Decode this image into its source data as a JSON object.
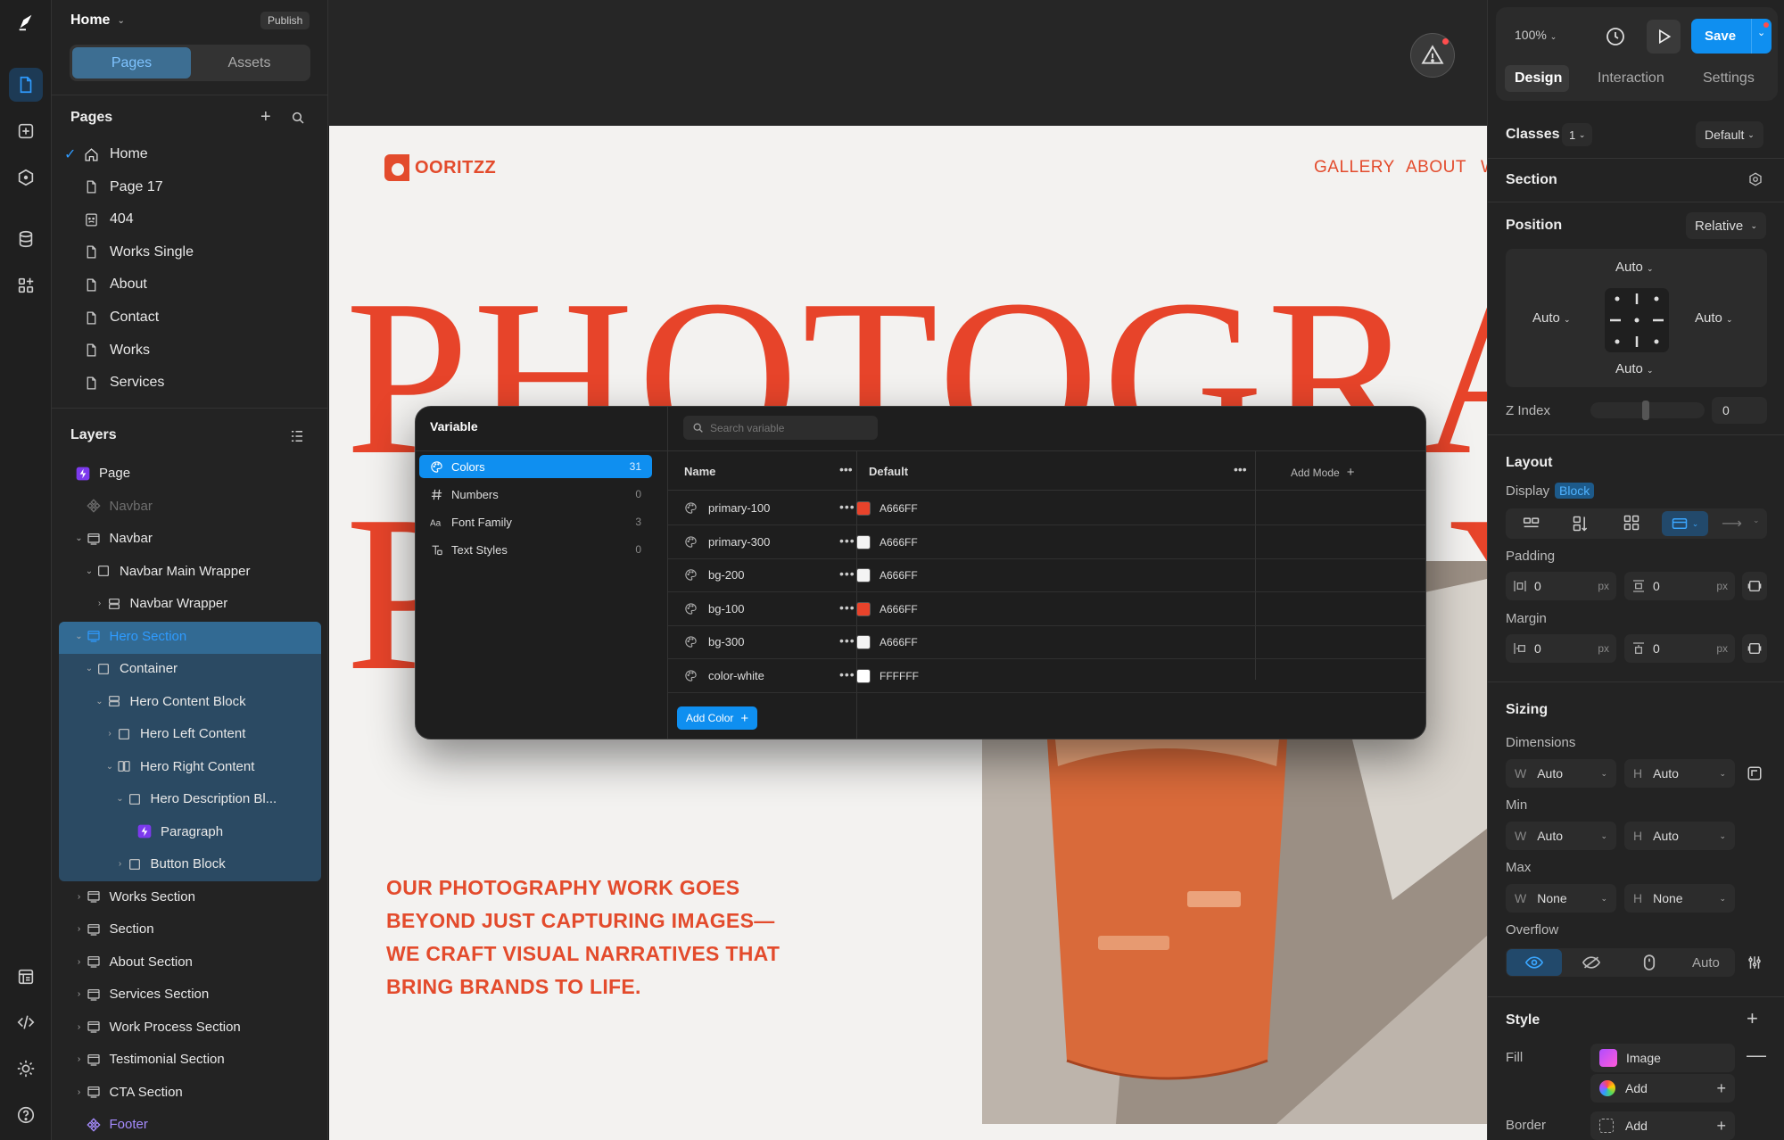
{
  "topbar": {
    "page_name": "Home",
    "publish": "Publish"
  },
  "left": {
    "tab_pages": "Pages",
    "tab_assets": "Assets",
    "pages_heading": "Pages",
    "pages": [
      "Home",
      "Page 17",
      "404",
      "Works Single",
      "About",
      "Contact",
      "Works",
      "Services"
    ],
    "layers_heading": "Layers",
    "layers": [
      {
        "label": "Page",
        "depth": 0,
        "icon": "bolt",
        "color": "#e8e8e8"
      },
      {
        "label": "Navbar",
        "depth": 1,
        "icon": "component",
        "color": "#6e6e6e"
      },
      {
        "label": "Navbar",
        "depth": 1,
        "icon": "section",
        "color": "#e8e8e8",
        "car": "v"
      },
      {
        "label": "Navbar Main Wrapper",
        "depth": 2,
        "icon": "box",
        "color": "#e8e8e8",
        "car": "v"
      },
      {
        "label": "Navbar Wrapper",
        "depth": 3,
        "icon": "stack",
        "color": "#e8e8e8",
        "car": ">"
      },
      {
        "label": "Hero Section",
        "depth": 1,
        "icon": "section",
        "color": "#2f9bff",
        "car": "v"
      },
      {
        "label": "Container",
        "depth": 2,
        "icon": "box",
        "color": "#e8e8e8",
        "car": "v"
      },
      {
        "label": "Hero Content Block",
        "depth": 3,
        "icon": "stack",
        "color": "#e8e8e8",
        "car": "v"
      },
      {
        "label": "Hero Left Content",
        "depth": 4,
        "icon": "box",
        "color": "#e8e8e8",
        "car": ">"
      },
      {
        "label": "Hero Right Content",
        "depth": 4,
        "icon": "cols",
        "color": "#e8e8e8",
        "car": "v"
      },
      {
        "label": "Hero Description Bl...",
        "depth": 5,
        "icon": "box",
        "color": "#e8e8e8",
        "car": "v"
      },
      {
        "label": "Paragraph",
        "depth": 6,
        "icon": "bolt",
        "color": "#e8e8e8"
      },
      {
        "label": "Button Block",
        "depth": 5,
        "icon": "box",
        "color": "#e8e8e8",
        "car": ">"
      },
      {
        "label": "Works Section",
        "depth": 1,
        "icon": "section",
        "color": "#e8e8e8",
        "car": ">"
      },
      {
        "label": "Section",
        "depth": 1,
        "icon": "section",
        "color": "#e8e8e8",
        "car": ">"
      },
      {
        "label": "About Section",
        "depth": 1,
        "icon": "section",
        "color": "#e8e8e8",
        "car": ">"
      },
      {
        "label": "Services Section",
        "depth": 1,
        "icon": "section",
        "color": "#e8e8e8",
        "car": ">"
      },
      {
        "label": "Work Process Section",
        "depth": 1,
        "icon": "section",
        "color": "#e8e8e8",
        "car": ">"
      },
      {
        "label": "Testimonial Section",
        "depth": 1,
        "icon": "section",
        "color": "#e8e8e8",
        "car": ">"
      },
      {
        "label": "CTA Section",
        "depth": 1,
        "icon": "section",
        "color": "#e8e8e8",
        "car": ">"
      },
      {
        "label": "Footer",
        "depth": 1,
        "icon": "component",
        "color": "#a68cff"
      }
    ]
  },
  "site": {
    "logo": "OORITZZ",
    "nav": [
      "GALLERY",
      "ABOUT",
      "W"
    ],
    "headline1": "PHOTOGRAPHY",
    "headline2": "P",
    "headline2b": "Y",
    "hero_text": "OUR PHOTOGRAPHY WORK GOES BEYOND JUST CAPTURING IMAGES— WE CRAFT VISUAL NARRATIVES THAT BRING BRANDS TO LIFE."
  },
  "variable_modal": {
    "title": "Variable",
    "search_placeholder": "Search variable",
    "categories": [
      {
        "label": "Colors",
        "count": "31",
        "icon": "palette"
      },
      {
        "label": "Numbers",
        "count": "0",
        "icon": "hash"
      },
      {
        "label": "Font Family",
        "count": "3",
        "icon": "aa"
      },
      {
        "label": "Text Styles",
        "count": "0",
        "icon": "textstyle"
      }
    ],
    "col_name": "Name",
    "col_default": "Default",
    "add_mode": "Add Mode",
    "rows": [
      {
        "name": "primary-100",
        "color": "#e8432b",
        "value": "A666FF"
      },
      {
        "name": "primary-300",
        "color": "#f4f4f4",
        "value": "A666FF"
      },
      {
        "name": "bg-200",
        "color": "#f4f4f4",
        "value": "A666FF"
      },
      {
        "name": "bg-100",
        "color": "#e8432b",
        "value": "A666FF"
      },
      {
        "name": "bg-300",
        "color": "#f4f4f4",
        "value": "A666FF"
      },
      {
        "name": "color-white",
        "color": "#ffffff",
        "value": "FFFFFF"
      }
    ],
    "add_color": "Add Color"
  },
  "right": {
    "zoom": "100%",
    "save": "Save",
    "tabs": [
      "Design",
      "Interaction",
      "Settings"
    ],
    "classes_label": "Classes",
    "classes_count": "1",
    "classes_state": "Default",
    "section_label": "Section",
    "position_label": "Position",
    "position_value": "Relative",
    "pos_top": "Auto",
    "pos_left": "Auto",
    "pos_right": "Auto",
    "pos_bottom": "Auto",
    "zindex_label": "Z Index",
    "zindex_value": "0",
    "layout_label": "Layout",
    "display_label": "Display",
    "display_value": "Block",
    "padding_label": "Padding",
    "padding_x": "0",
    "padding_y": "0",
    "margin_label": "Margin",
    "margin_x": "0",
    "margin_y": "0",
    "unit": "px",
    "sizing_label": "Sizing",
    "dimensions_label": "Dimensions",
    "dim_w": "Auto",
    "dim_h": "Auto",
    "min_label": "Min",
    "min_w": "Auto",
    "min_h": "Auto",
    "max_label": "Max",
    "max_w": "None",
    "max_h": "None",
    "overflow_label": "Overflow",
    "overflow_auto": "Auto",
    "w_letter": "W",
    "h_letter": "H",
    "style_label": "Style",
    "fill_label": "Fill",
    "fill_image": "Image",
    "fill_add": "Add",
    "border_label": "Border",
    "border_add": "Add"
  }
}
